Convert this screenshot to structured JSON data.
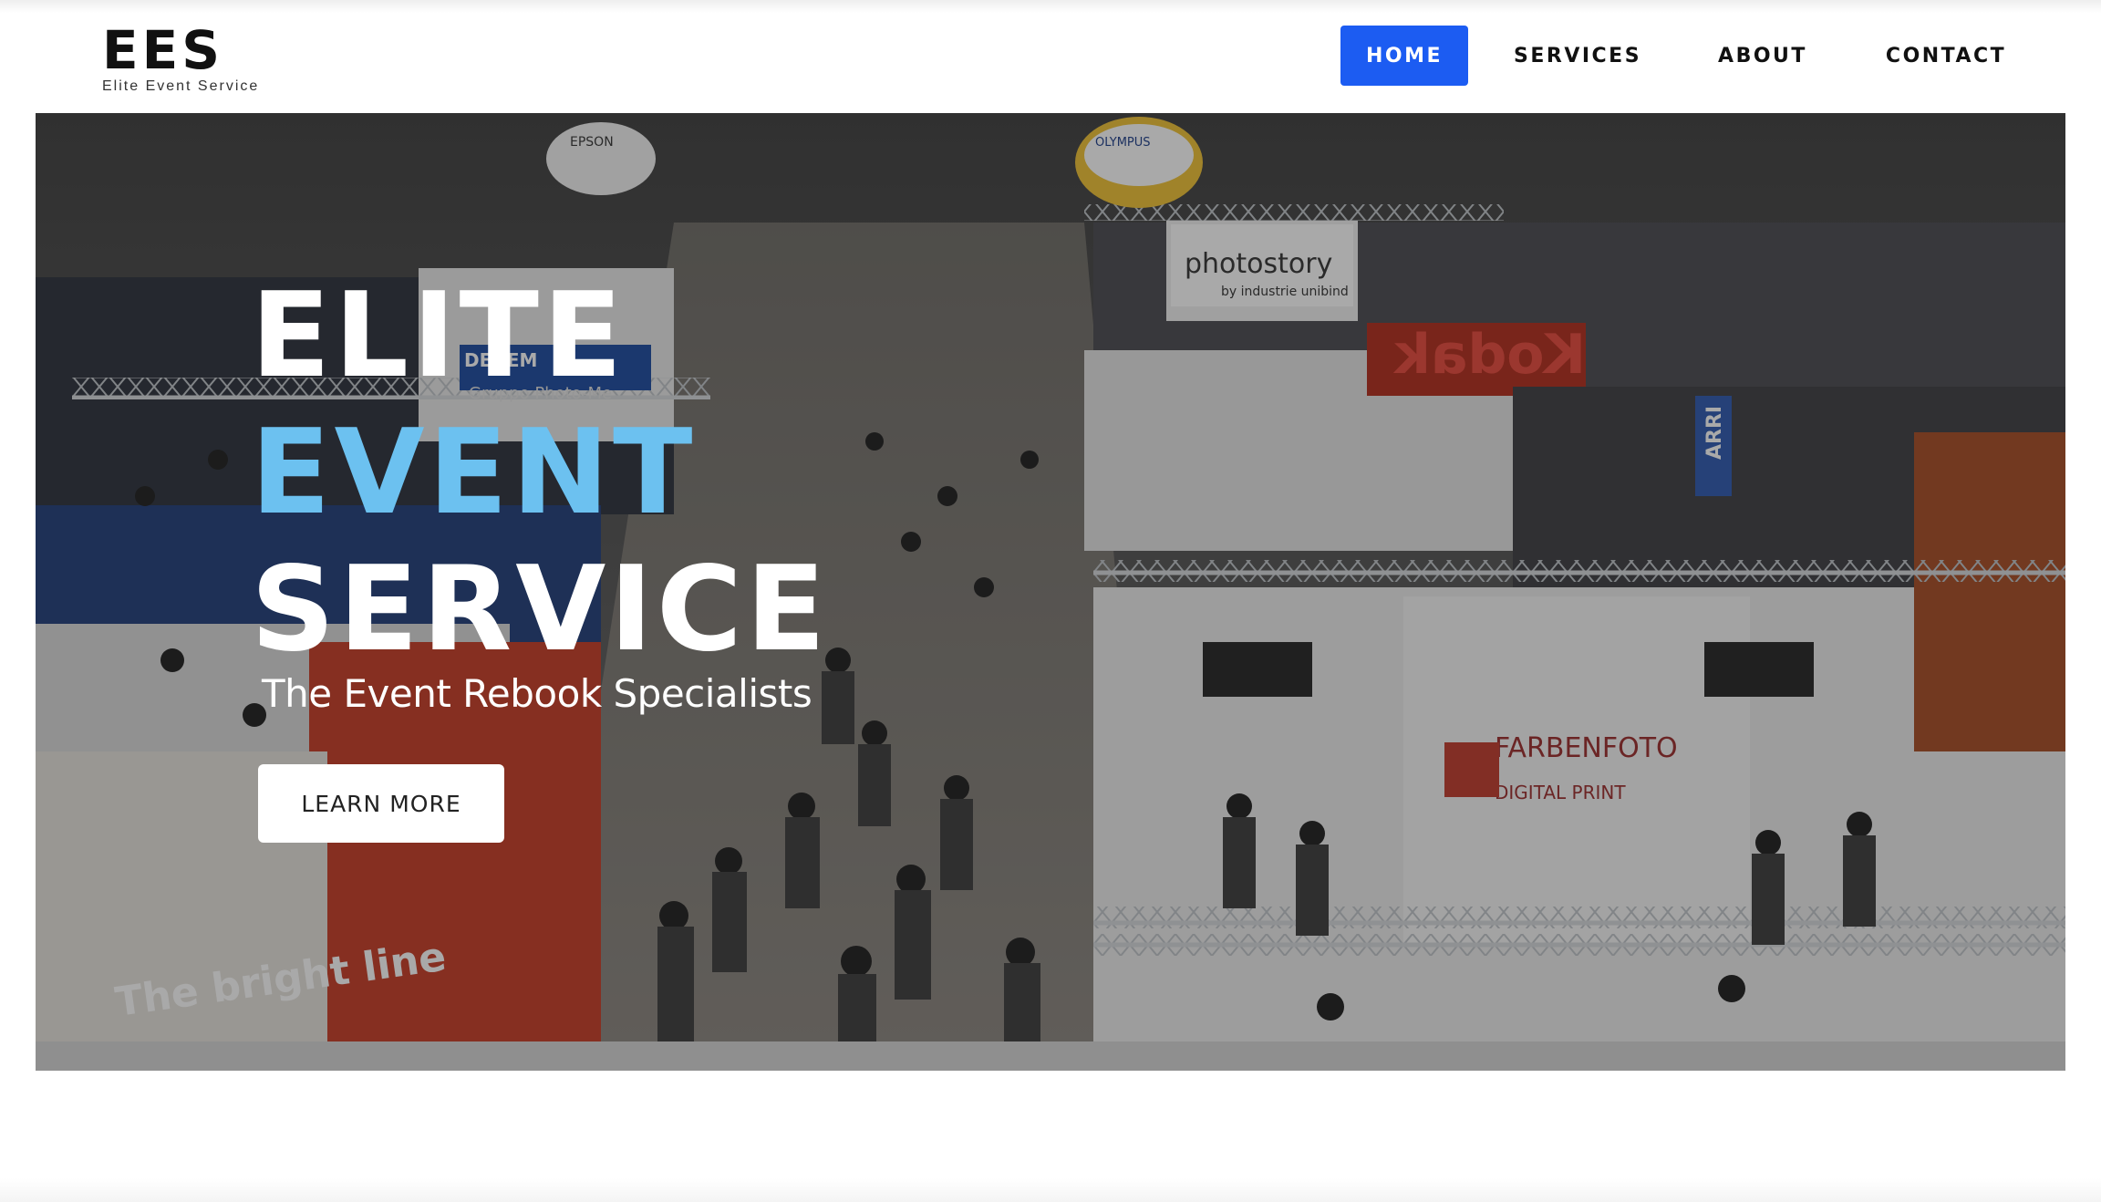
{
  "logo": {
    "mark": "EES",
    "tagline": "Elite Event Service"
  },
  "nav": {
    "items": [
      {
        "label": "HOME",
        "active": true
      },
      {
        "label": "SERVICES",
        "active": false
      },
      {
        "label": "ABOUT",
        "active": false
      },
      {
        "label": "CONTACT",
        "active": false
      }
    ]
  },
  "hero": {
    "title_line1": "ELITE",
    "title_line2": "EVENT",
    "title_line3": "SERVICE",
    "subtitle": "The Event Rebook Specialists",
    "cta_label": "LEARN MORE"
  },
  "photo_signs": {
    "booth_top": "photostory",
    "booth_top_sub": "by industrie unibind",
    "kodak": "Kodak",
    "epson": "EPSON",
    "olympus": "OLYMPUS",
    "gruppo": "Gruppo Photo-Me",
    "dedem": "DEDEM",
    "farbenfoto": "FARBENFOTO",
    "digital_print": "DIGITAL PRINT",
    "arri": "ARRI",
    "bright": "The bright line"
  },
  "colors": {
    "nav_active_bg": "#1c5cf2",
    "accent_text": "#6cc1f0",
    "text_dark": "#111111"
  }
}
